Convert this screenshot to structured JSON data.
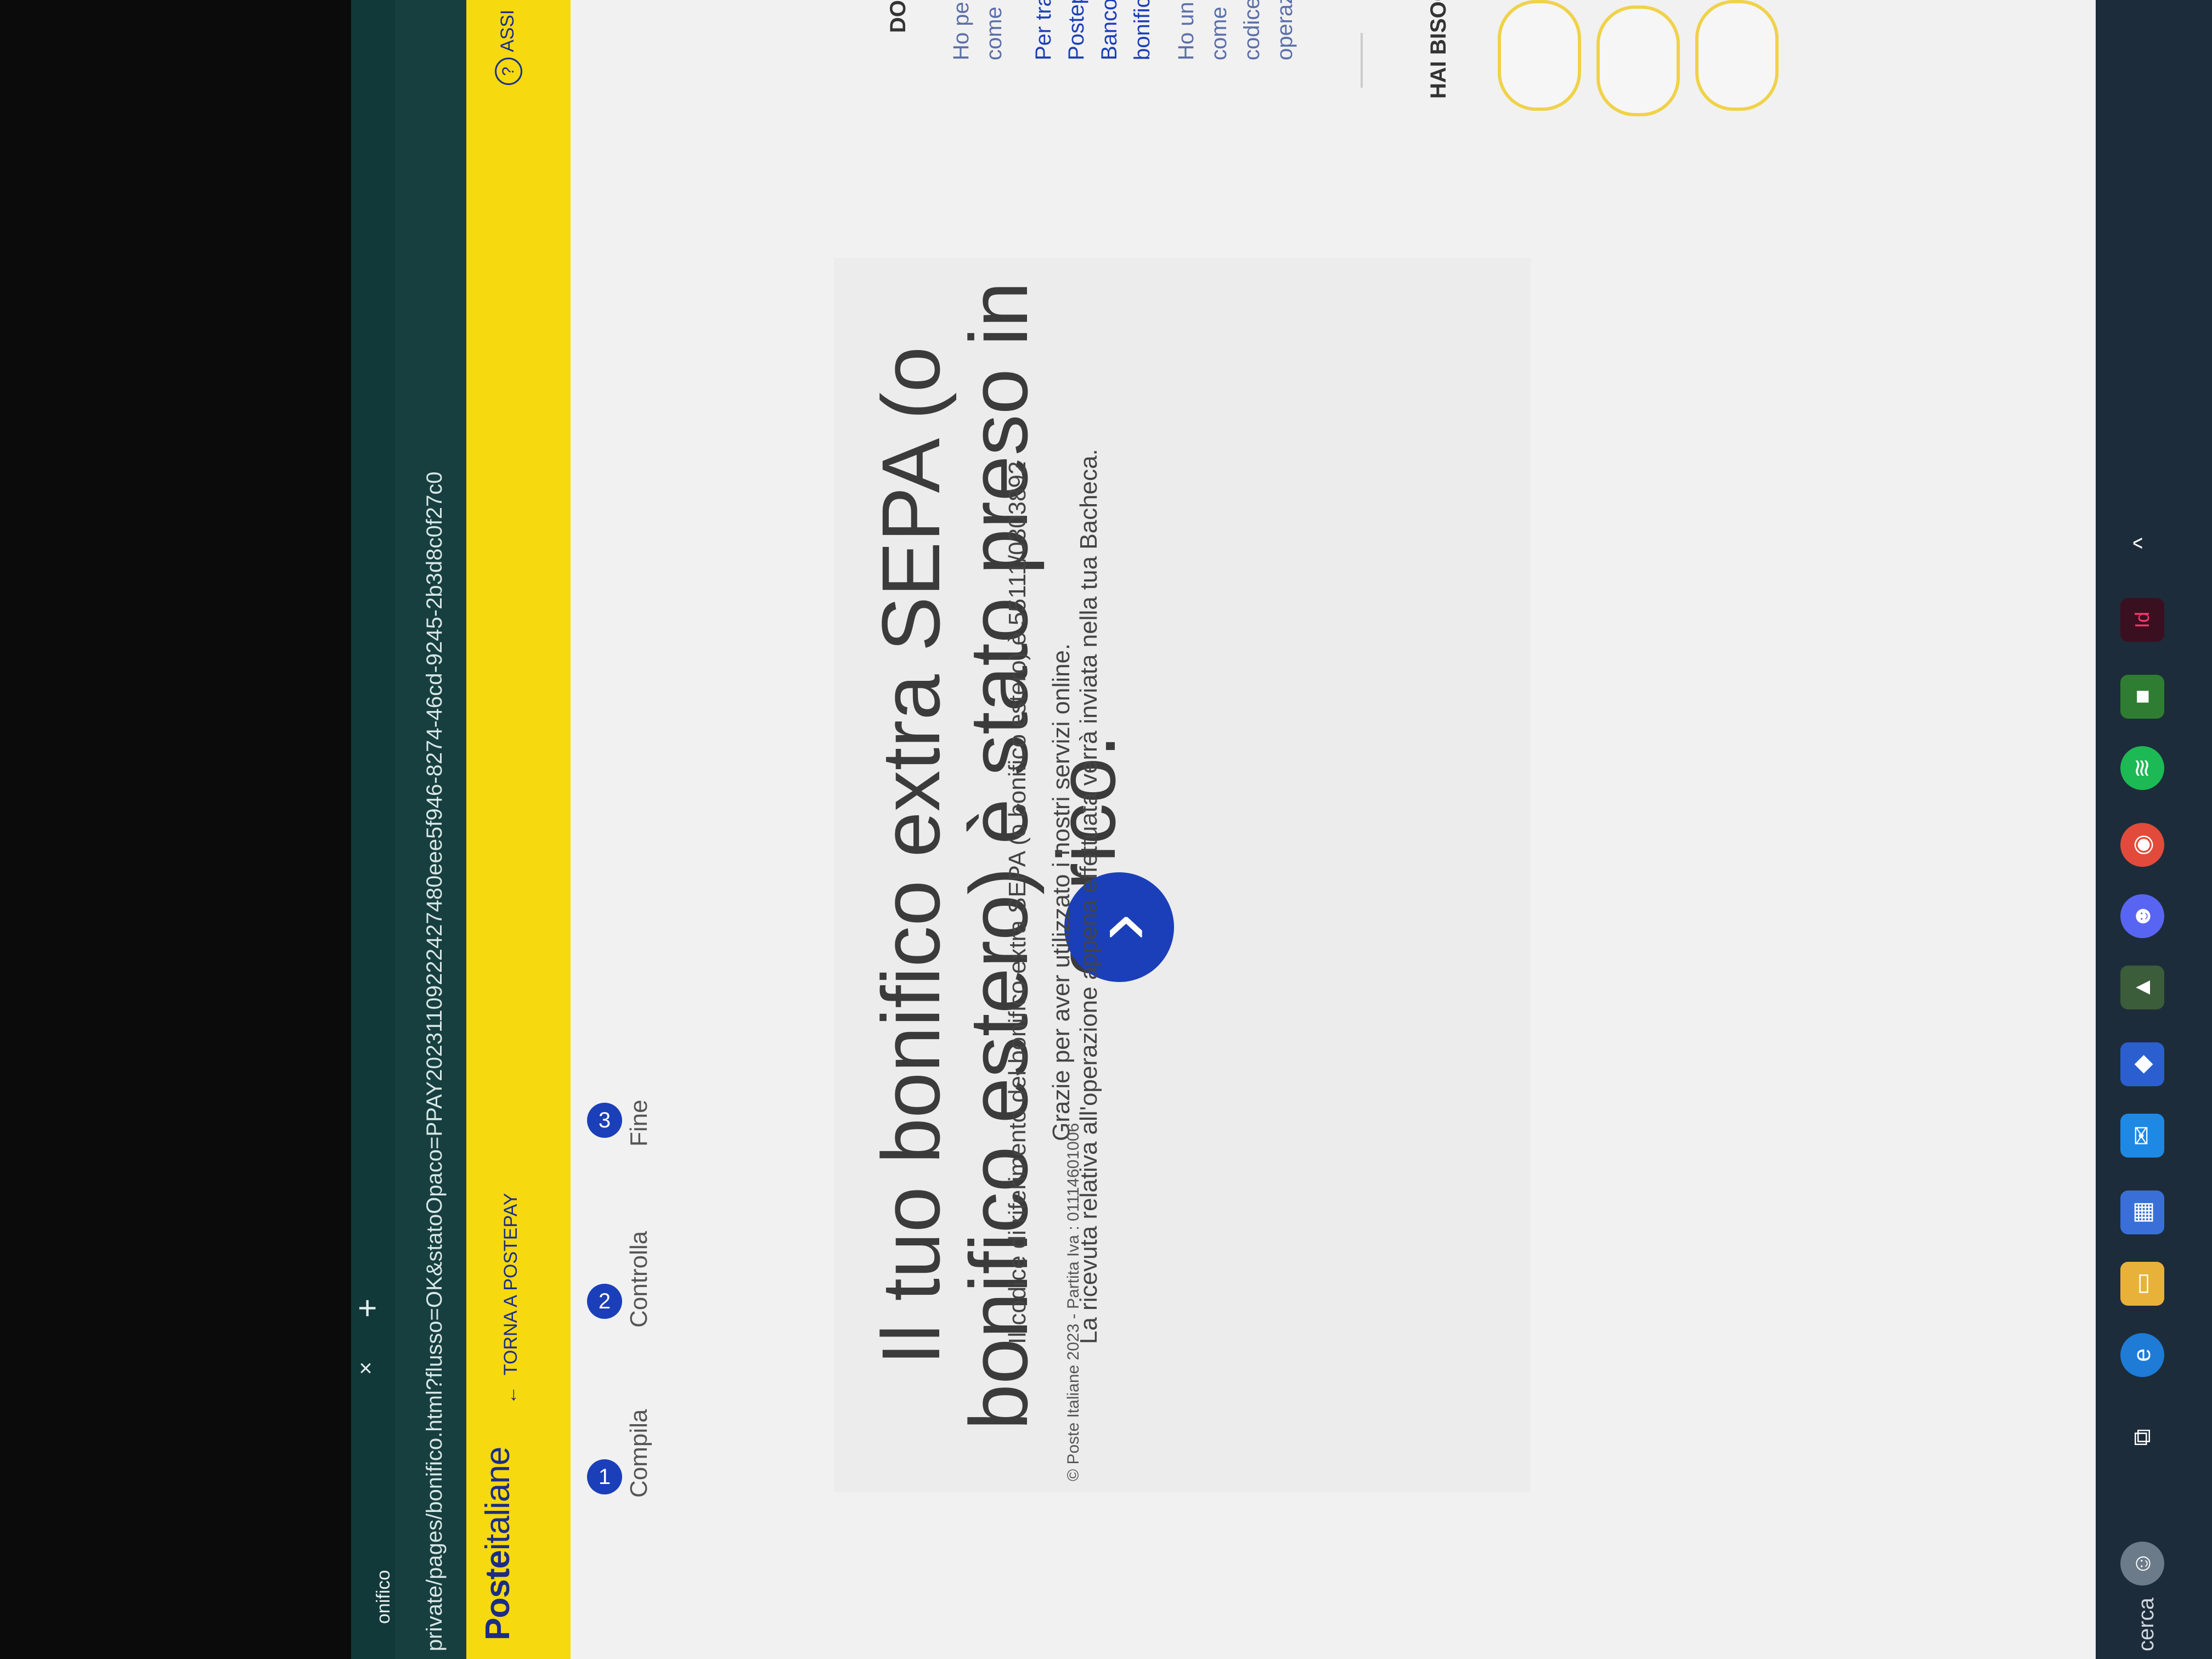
{
  "browser": {
    "tab_title": "onifico",
    "tab_close": "×",
    "new_tab": "+",
    "url": "private/pages/bonifico.html?flusso=OK&statoOpaco=PPAY20231109222427480eee5f946-8274-46cd-9245-2b3d8c0f27c0"
  },
  "header": {
    "logo_bold": "Poste",
    "logo_rest": "italiane",
    "back_label": "TORNA A POSTEPAY",
    "back_icon": "←",
    "help_label": "ASSI",
    "help_icon": "?"
  },
  "stepper": {
    "steps": [
      {
        "number": "1",
        "label": "Compila"
      },
      {
        "number": "2",
        "label": "Controlla"
      },
      {
        "number": "3",
        "label": "Fine"
      }
    ]
  },
  "result": {
    "title": "Il tuo bonifico extra SEPA (o bonifico estero) è stato preso in carico.",
    "check_icon": "›",
    "reference_text": "Il codice di riferimento del bonifico extra SEPA (o bonifico estero) è 55111/0303892",
    "thanks_text": "Grazie per aver utilizzato i nostri servizi online.",
    "receipt_text": "La ricevuta relativa all'operazione appena effettuata verrà inviata nella tua Bacheca."
  },
  "faq": {
    "heading": "DOMA",
    "lines": [
      "Ho pe",
      "come",
      "Per tra",
      "Postep",
      "Banco",
      "bonific",
      "Ho un r",
      "come p",
      "codice s",
      "operazio"
    ],
    "need_help_heading": "HAI BISOG"
  },
  "footer": {
    "text": "© Poste Italiane 2023 - Partita Iva : 01114601006"
  },
  "taskbar": {
    "search_label": "cerca",
    "items": [
      "task-view",
      "edge",
      "file-explorer",
      "store",
      "mail",
      "azure",
      "minecraft-legends",
      "discord",
      "chrome",
      "spotify",
      "minecraft",
      "indesign",
      "chevron-up"
    ]
  },
  "colors": {
    "brand_yellow": "#f6d90f",
    "brand_blue": "#1b2d87",
    "accent_blue": "#1b3fb8",
    "chrome_teal": "#12393a"
  }
}
